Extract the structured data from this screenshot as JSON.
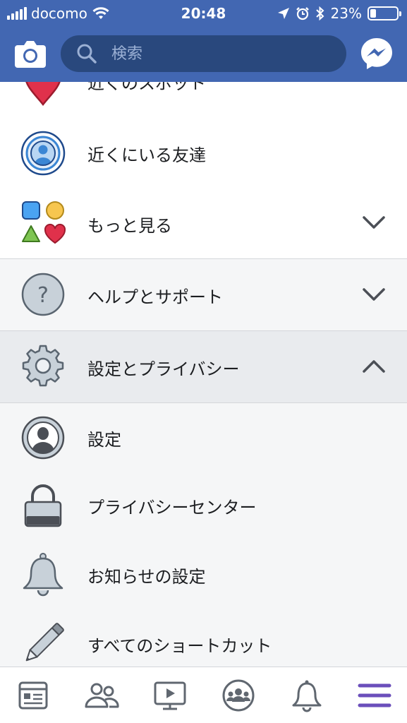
{
  "status_bar": {
    "carrier": "docomo",
    "time": "20:48",
    "battery": "23%",
    "battery_level": 0.23
  },
  "header": {
    "search_placeholder": "検索",
    "icons": [
      "camera-icon",
      "search-icon",
      "messenger-icon"
    ]
  },
  "menu": {
    "nearby_places": "近くのスポット",
    "nearby_friends": "近くにいる友達",
    "see_more": "もっと見る",
    "help_support": "ヘルプとサポート",
    "settings_privacy": "設定とプライバシー",
    "settings": "設定",
    "privacy_center": "プライバシーセンター",
    "notification_settings": "お知らせの設定",
    "all_shortcuts": "すべてのショートカット"
  },
  "tab_bar": {
    "tabs": [
      "news-feed-icon",
      "friends-icon",
      "watch-icon",
      "groups-icon",
      "notifications-icon",
      "menu-icon"
    ],
    "active_tab": "menu-icon"
  },
  "colors": {
    "brand_blue": "#4267b2",
    "search_bg": "#29487d",
    "active_tab": "#6b4fbb"
  }
}
